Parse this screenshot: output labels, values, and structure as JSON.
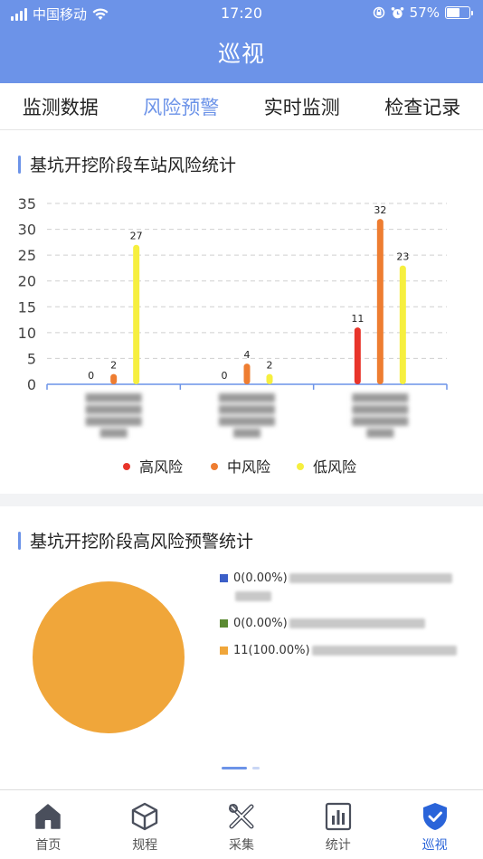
{
  "status_bar": {
    "carrier": "中国移动",
    "time": "17:20",
    "battery_text": "57%",
    "battery_level": 0.57
  },
  "header": {
    "title": "巡视"
  },
  "tabs": [
    {
      "label": "监测数据",
      "active": false
    },
    {
      "label": "风险预警",
      "active": true
    },
    {
      "label": "实时监测",
      "active": false
    },
    {
      "label": "检查记录",
      "active": false
    }
  ],
  "section1": {
    "title": "基坑开挖阶段车站风险统计"
  },
  "section2": {
    "title": "基坑开挖阶段高风险预警统计"
  },
  "chart_data": [
    {
      "type": "bar",
      "categories": [
        "",
        "",
        ""
      ],
      "series": [
        {
          "name": "高风险",
          "color": "#e8342a",
          "values": [
            0,
            0,
            11
          ]
        },
        {
          "name": "中风险",
          "color": "#ee7d31",
          "values": [
            2,
            4,
            32
          ]
        },
        {
          "name": "低风险",
          "color": "#f6ef3f",
          "values": [
            27,
            2,
            23
          ]
        }
      ],
      "ylim": [
        0,
        35
      ],
      "yticks": [
        0,
        5,
        10,
        15,
        20,
        25,
        30,
        35
      ],
      "grid": true,
      "legend": "bottom"
    },
    {
      "type": "pie",
      "labels": [
        "",
        "",
        ""
      ],
      "values": [
        0,
        0,
        11
      ],
      "colors": [
        "#3b5fc8",
        "#5b8a32",
        "#f0a63a"
      ],
      "value_labels": [
        "0(0.00%)",
        "0(0.00%)",
        "11(100.00%)"
      ],
      "legend": "right"
    }
  ],
  "bottom_nav": [
    {
      "label": "首页",
      "icon": "home-icon",
      "active": false
    },
    {
      "label": "规程",
      "icon": "cube-icon",
      "active": false
    },
    {
      "label": "采集",
      "icon": "tools-icon",
      "active": false
    },
    {
      "label": "统计",
      "icon": "bar-chart-icon",
      "active": false
    },
    {
      "label": "巡视",
      "icon": "shield-check-icon",
      "active": true
    }
  ]
}
